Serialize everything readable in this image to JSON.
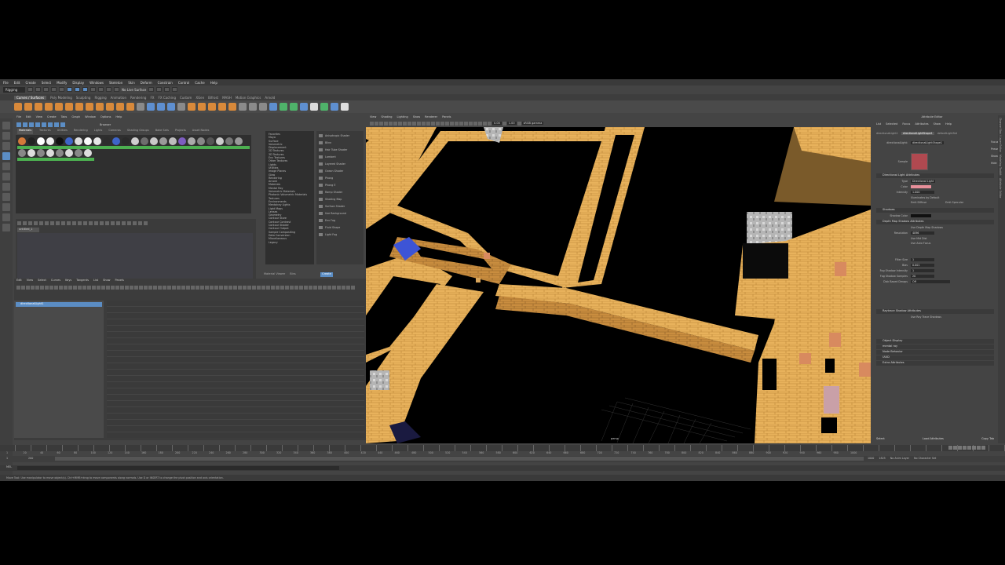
{
  "menubar": [
    "File",
    "Edit",
    "Create",
    "Select",
    "Modify",
    "Display",
    "Windows",
    "Skeleton",
    "Skin",
    "Deform",
    "Constrain",
    "Control",
    "Cache",
    "Help"
  ],
  "statusline": {
    "mode": "Rigging",
    "live": "No Live Surface"
  },
  "shelf_tabs": [
    "Curves / Surfaces",
    "Poly Modeling",
    "Sculpting",
    "Rigging",
    "Animation",
    "Rendering",
    "FX",
    "FX Caching",
    "Custom",
    "XGen",
    "Bifrost",
    "MASH",
    "Motion Graphics",
    "Arnold"
  ],
  "shelf_active": "Curves / Surfaces",
  "hypershade": {
    "menu": [
      "File",
      "Edit",
      "View",
      "Create",
      "Tabs",
      "Graph",
      "Window",
      "Options",
      "Help"
    ],
    "tabs": [
      "Materials",
      "Textures",
      "Utilities",
      "Rendering",
      "Lights",
      "Cameras",
      "Shading Groups",
      "Bake Sets",
      "Projects",
      "Asset Nodes"
    ],
    "active_tab": "Materials",
    "browser_label": "Browser",
    "create_label": "Create",
    "shader_tab": "untitled_1",
    "create_tree": [
      "Favorites",
      "Maya",
      "Surface",
      "Volumetric",
      "Displacement",
      "2D Textures",
      "3D Textures",
      "Env Textures",
      "Other Textures",
      "Lights",
      "Utilities",
      "Image Planes",
      "Glow",
      "Rendering",
      "Arnold",
      "Materials",
      "Mental Ray",
      "Volumetric Materials",
      "Photonic Volumetric Materials",
      "Textures",
      "Environments",
      "Mentalray Lights",
      "Light Maps",
      "Lenses",
      "Geometry",
      "Contour Store",
      "Contour Contrast",
      "Contour Shader",
      "Contour Output",
      "Sample Compositing",
      "Data Conversion",
      "Miscellaneous",
      "Legacy"
    ],
    "create_list": [
      "Anisotropic Shader",
      "Blinn",
      "Hair Tube Shader",
      "Lambert",
      "Layered Shader",
      "Ocean Shader",
      "Phong",
      "Phong E",
      "Ramp Shader",
      "Shading Map",
      "Surface Shader",
      "Use Background",
      "Env Fog",
      "Fluid Shape",
      "Light Fog"
    ],
    "bottom": [
      "Material Viewer",
      "Bins"
    ]
  },
  "graph_editor": {
    "menu": [
      "Edit",
      "View",
      "Select",
      "Curves",
      "Keys",
      "Tangents",
      "List",
      "Show",
      "Panels"
    ],
    "outliner_item": "directionalLight1"
  },
  "viewport": {
    "menu": [
      "View",
      "Shading",
      "Lighting",
      "Show",
      "Renderer",
      "Panels"
    ],
    "field_a": "0.00",
    "field_b": "1.00",
    "colorspace": "sRGB gamma",
    "camera": "persp"
  },
  "attribute_editor": {
    "title": "Attribute Editor",
    "menu": [
      "List",
      "Selected",
      "Focus",
      "Attributes",
      "Show",
      "Help"
    ],
    "tabs": [
      "directionalLight1",
      "directionalLightShape1",
      "defaultLightSet"
    ],
    "active_tab": "directionalLightShape1",
    "node_label": "directionalLight:",
    "node_value": "directionalLightShape1",
    "sample_label": "Sample",
    "side_buttons": [
      "Focus",
      "Presets",
      "Show",
      "Hide"
    ],
    "sections": {
      "s1": "Directional Light Attributes",
      "s2": "Shadows",
      "s3": "Depth Map Shadow Attributes",
      "s4": "Raytrace Shadow Attributes",
      "s5": "Object Display",
      "s6": "mental ray",
      "s7": "Node Behavior",
      "s8": "UUID",
      "s9": "Extra Attributes"
    },
    "type_label": "Type",
    "type_value": "Directional Light",
    "color_label": "Color",
    "color_hex": "#e78f9a",
    "intensity_label": "Intensity",
    "intensity_value": "1.000",
    "illum_default": "Illuminates by Default",
    "emit_diffuse": "Emit Diffuse",
    "emit_specular": "Emit Specular",
    "shadow_color_label": "Shadow Color",
    "use_depth_map": "Use Depth Map Shadows",
    "resolution_label": "Resolution",
    "resolution_value": "4096",
    "use_mid_dist": "Use Mid Dist",
    "use_auto_focus": "Use Auto Focus",
    "filter_size_label": "Filter Size",
    "filter_size_value": "1",
    "bias_label": "Bias",
    "bias_value": "0.001",
    "fog_intensity_label": "Fog Shadow Intensity",
    "fog_intensity_value": "1",
    "fog_samples_label": "Fog Shadow Samples",
    "fog_samples_value": "20",
    "disk_label": "Disk Based Dmaps",
    "disk_value": "Off",
    "use_ray_trace": "Use Ray Trace Shadows",
    "bottom": [
      "Select",
      "Load Attributes",
      "Copy Tab"
    ]
  },
  "time": {
    "ticks": [
      "1",
      "20",
      "40",
      "60",
      "80",
      "100",
      "120",
      "140",
      "160",
      "180",
      "200",
      "220",
      "240",
      "260",
      "280",
      "300",
      "320",
      "340",
      "360",
      "380",
      "400",
      "420",
      "440",
      "460",
      "480",
      "500",
      "520",
      "540",
      "560",
      "580",
      "600",
      "620",
      "640",
      "660",
      "680",
      "700",
      "720",
      "740",
      "760",
      "780",
      "800",
      "820",
      "840",
      "860",
      "880",
      "900",
      "920",
      "940",
      "960",
      "980",
      "1000"
    ],
    "start": "1",
    "end": "1000",
    "current": "200",
    "end_field_a": "1000",
    "end_field_b": "1825",
    "anim_layer": "No Anim Layer",
    "char_set": "No Character Set"
  },
  "cmd_label": "MEL",
  "help_text": "Move Tool: Use manipulator to move object(s). Ctrl+MMB+drag to move components along normals. Use D or INSERT to change the pivot position and axis orientation.",
  "right_strip": [
    "Channel Box / Layer Editor",
    "Modeling Toolkit",
    "Attribute Editor"
  ]
}
